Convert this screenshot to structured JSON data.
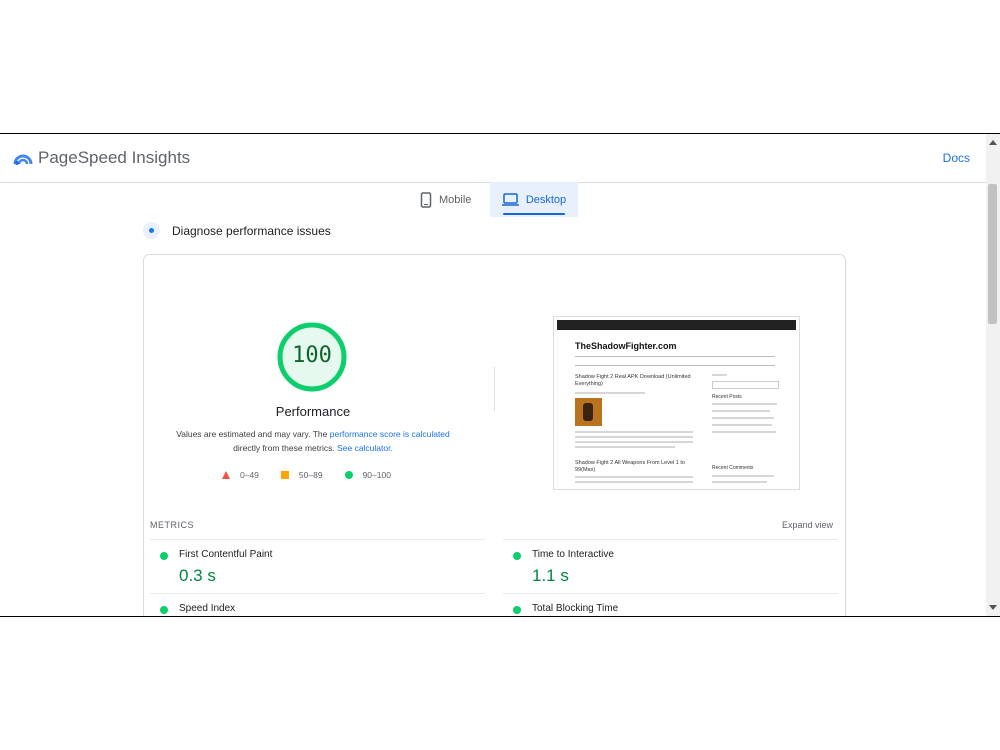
{
  "header": {
    "brand": "PageSpeed Insights",
    "docs_label": "Docs",
    "logo_icon": "pagespeed-logo-icon"
  },
  "tabs": [
    {
      "label": "Mobile",
      "icon": "phone-icon",
      "selected": false
    },
    {
      "label": "Desktop",
      "icon": "laptop-icon",
      "selected": true
    }
  ],
  "diagnose": {
    "label": "Diagnose performance issues"
  },
  "performance": {
    "score": "100",
    "title": "Performance",
    "note_prefix": "Values are estimated and may vary. The ",
    "note_link1": "performance score is calculated",
    "note_middle": " directly from these metrics. ",
    "note_link2": "See calculator.",
    "score_color": "#0cce6b"
  },
  "legend": [
    {
      "label": "0–49",
      "shape": "triangle",
      "color": "#ff4e42"
    },
    {
      "label": "50–89",
      "shape": "square",
      "color": "#ffa400"
    },
    {
      "label": "90–100",
      "shape": "circle",
      "color": "#0cce6b"
    }
  ],
  "screenshot": {
    "site_title": "TheShadowFighter.com",
    "post1_title": "Shadow Fight 2 Real APK Download (Unlimited Everything)",
    "post2_title": "Shadow Fight 2 All Weapons From Level 1 to 99(Max)",
    "sidebar_recent_posts": "Recent Posts",
    "sidebar_recent_comments": "Recent Comments"
  },
  "metrics": {
    "label": "METRICS",
    "expand_label": "Expand view",
    "items": [
      {
        "name": "First Contentful Paint",
        "value": "0.3 s"
      },
      {
        "name": "Time to Interactive",
        "value": "1.1 s"
      },
      {
        "name": "Speed Index",
        "value": ""
      },
      {
        "name": "Total Blocking Time",
        "value": ""
      }
    ]
  }
}
